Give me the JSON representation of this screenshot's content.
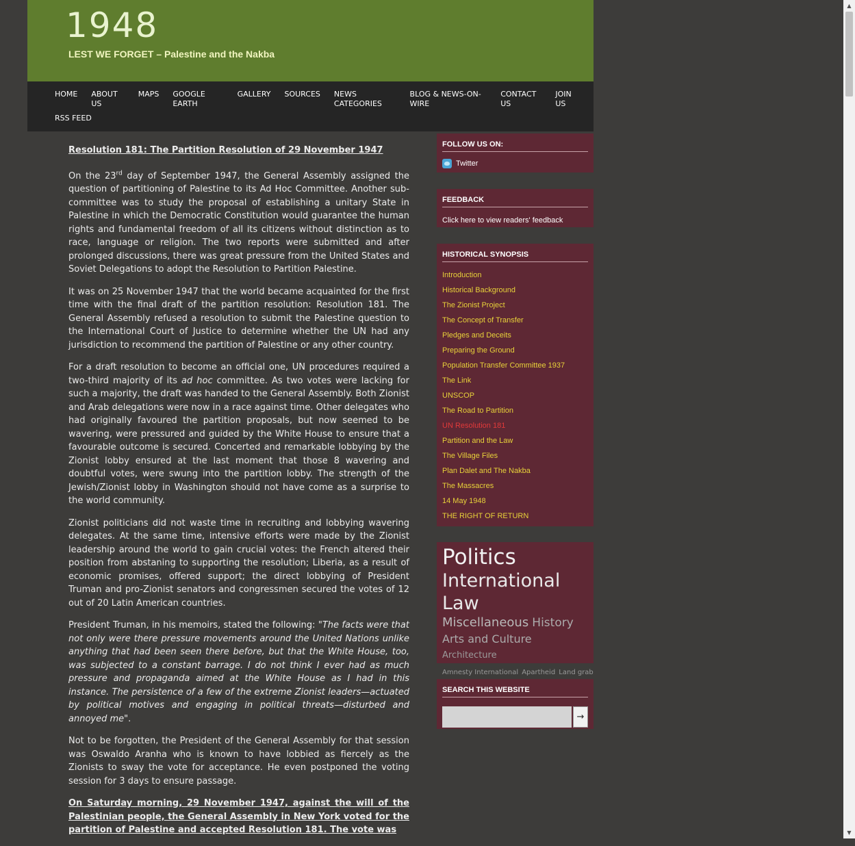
{
  "header": {
    "title": "1948",
    "tagline": "LEST WE FORGET – Palestine and the Nakba"
  },
  "nav": {
    "row1": [
      "HOME",
      "ABOUT US",
      "MAPS",
      "GOOGLE EARTH",
      "GALLERY",
      "SOURCES",
      "NEWS CATEGORIES",
      "BLOG & NEWS-ON-WIRE",
      "CONTACT US",
      "JOIN US"
    ],
    "row2": [
      "RSS FEED"
    ]
  },
  "article": {
    "heading": "Resolution 181: The Partition Resolution of 29 November 1947",
    "p1_a": "On the 23",
    "p1_sup": "rd",
    "p1_b": " day of September 1947, the General Assembly assigned the question of partitioning of Palestine to its Ad Hoc Committee. Another sub-committee was to study the proposal of establishing a unitary State in Palestine in which the Democratic Constitution would guarantee the human rights and fundamental freedom of all its citizens without distinction as to race, language or religion. The two reports were submitted and after prolonged discussions, there was great pressure from the United States and Soviet Delegations to adopt the Resolution to Partition Palestine.",
    "p2": "It was on 25 November 1947 that the world became acquainted for the first time with the final draft of the partition resolution: Resolution 181. The General Assembly refused a resolution to submit the Palestine question to the International Court of Justice to determine whether the UN had any jurisdiction to recommend the partition of Palestine or any other country.",
    "p3_a": "For a draft resolution to become an official one, UN procedures required a two-third majority of its ",
    "p3_em": "ad hoc",
    "p3_b": " committee. As two votes were lacking for such a majority, the draft was handed to the General Assembly. Both Zionist and Arab delegations were now in a race against time. Other delegates who had originally favoured the partition proposals, but now seemed to be wavering, were pressured and guided by the White House to ensure that a favourable outcome is secured. Concerted and remarkable lobbying by the Zionist lobby ensured at the last moment that those 8 wavering and doubtful votes, were swung into the partition lobby. The strength of the Jewish/Zionist lobby in Washington should not have come as a surprise to the world community.",
    "p4": "Zionist politicians did not waste time in recruiting and lobbying wavering delegates. At the same time, intensive efforts were made by the Zionist leadership around the world to gain crucial votes: the French altered their position from abstaning to supporting the resolution; Liberia, as a result of economic promises, offered support; the direct lobbying of President Truman and pro-Zionist senators and congressmen secured the votes of 12 out of 20 Latin American countries.",
    "p5_a": "President Truman, in his memoirs, stated the following: ",
    "p5_em": "\"The facts were that not only were there pressure movements around the United Nations unlike anything that had been seen there before, but that the White House, too, was subjected to a constant barrage. I do not think I ever had as much pressure and propaganda aimed at the White House as I had in this instance. The persistence of a few of the extreme Zionist leaders—actuated by political motives and engaging in political threats—disturbed and annoyed me",
    "p5_b": "\".",
    "p6": "Not to be forgotten, the President of the General Assembly for that session was Oswaldo Aranha who is known to have lobbied as fiercely as the Zionists to sway the vote for acceptance. He even postponed the voting session for 3 days to ensure passage.",
    "p7": "On Saturday morning, 29 November 1947, against the will of the Palestinian people, the General Assembly in New York voted for the partition of Palestine and accepted Resolution 181. The vote was"
  },
  "sidebar": {
    "follow": {
      "title": "FOLLOW US ON:",
      "twitter": "Twitter"
    },
    "feedback": {
      "title": "FEEDBACK",
      "link": "Click here to view readers' feedback"
    },
    "history": {
      "title": "HISTORICAL SYNOPSIS",
      "items": [
        "Introduction",
        "Historical Background",
        "The Zionist Project",
        "The Concept of Transfer",
        "Pledges and Deceits",
        "Preparing the Ground",
        "Population Transfer Committee 1937",
        "The Link",
        "UNSCOP",
        "The Road to Partition",
        "UN Resolution 181",
        "Partition and the Law",
        "The Village Files",
        "Plan Dalet and The Nakba",
        "The Massacres",
        "14 May 1948",
        "THE RIGHT OF RETURN"
      ],
      "active_index": 10
    },
    "tags": {
      "t_politics": "Politics",
      "t_intlaw": "International Law",
      "t_misc": "Miscellaneous",
      "t_history": "History",
      "t_arts": "Arts and Culture",
      "t_arch": "Architecture",
      "t_amnesty": "Amnesty International",
      "t_apartheid": "Apartheid",
      "t_landgrab": "Land grab"
    },
    "search": {
      "title": "SEARCH THIS WEBSITE",
      "button": "→",
      "placeholder": ""
    }
  },
  "colors": {
    "header_bg": "#5f7d2e",
    "nav_bg": "#252525",
    "sidebar_bg": "#5e2834",
    "link_yellow": "#e8d23a",
    "link_active": "#e23a3a",
    "page_bg": "#3d3c3a"
  },
  "icons": {
    "twitter": "twitter-bird-icon",
    "scroll_up": "scroll-up-arrow-icon",
    "scroll_down": "scroll-down-arrow-icon"
  }
}
